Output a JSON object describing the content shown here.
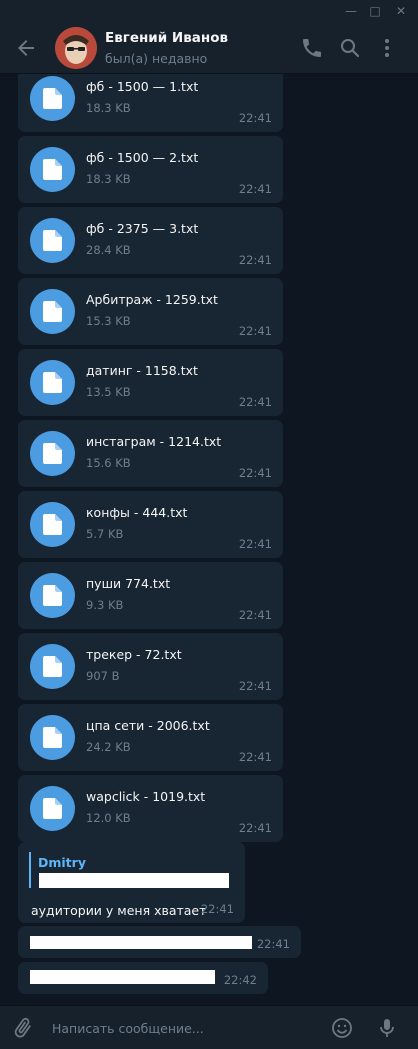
{
  "window": {
    "minimize_glyph": "—",
    "maximize_glyph": "□",
    "close_glyph": "✕"
  },
  "header": {
    "contact_name": "Евгений Иванов",
    "status": "был(а) недавно"
  },
  "files": [
    {
      "name": "фб - 1500 — 1.txt",
      "size": "18.3 KB",
      "time": "22:41"
    },
    {
      "name": "фб - 1500 — 2.txt",
      "size": "18.3 KB",
      "time": "22:41"
    },
    {
      "name": "фб - 2375 — 3.txt",
      "size": "28.4 KB",
      "time": "22:41"
    },
    {
      "name": "Арбитраж - 1259.txt",
      "size": "15.3 KB",
      "time": "22:41"
    },
    {
      "name": "датинг - 1158.txt",
      "size": "13.5 KB",
      "time": "22:41"
    },
    {
      "name": "инстаграм - 1214.txt",
      "size": "15.6 KB",
      "time": "22:41"
    },
    {
      "name": "конфы - 444.txt",
      "size": "5.7 KB",
      "time": "22:41"
    },
    {
      "name": "пуши 774.txt",
      "size": "9.3 KB",
      "time": "22:41"
    },
    {
      "name": "трекер - 72.txt",
      "size": "907 B",
      "time": "22:41"
    },
    {
      "name": "цпа сети - 2006.txt",
      "size": "24.2 KB",
      "time": "22:41"
    },
    {
      "name": "wapclick - 1019.txt",
      "size": "12.0 KB",
      "time": "22:41"
    }
  ],
  "text_messages": [
    {
      "reply_name": "Dmitry",
      "text": "аудитории у меня хватает",
      "time": "22:41"
    },
    {
      "text": "",
      "time": "22:41"
    },
    {
      "text": "",
      "time": "22:42"
    }
  ],
  "composer": {
    "placeholder": "Написать сообщение..."
  },
  "colors": {
    "background": "#0e1621",
    "header": "#17212b",
    "bubble": "#182533",
    "accent": "#4c9ce2",
    "reply_accent": "#5eb5f7",
    "muted": "#6d7f8f"
  },
  "icons": [
    "back-arrow-icon",
    "phone-icon",
    "search-icon",
    "more-vertical-icon",
    "file-icon",
    "paperclip-icon",
    "emoji-icon",
    "microphone-icon"
  ]
}
